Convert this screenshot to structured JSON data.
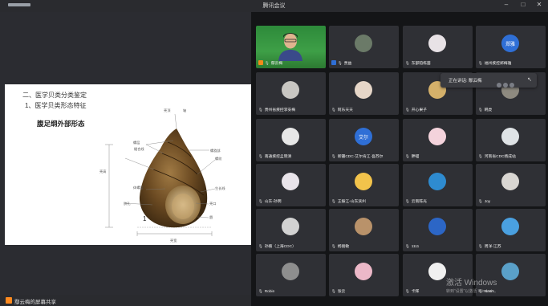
{
  "app": {
    "title": "腾讯会议"
  },
  "window_controls": {
    "minimize": "–",
    "maximize": "□",
    "close": "✕"
  },
  "slide": {
    "heading1": "二、医学贝类分类鉴定",
    "heading2": "1、医学贝类形态特征",
    "figure_title": "腹足纲外部形态",
    "labels": {
      "apex": "壳顶",
      "whorl": "螺层",
      "body_whorl": "体螺层",
      "shell_height": "壳高",
      "suture": "缝合线",
      "spire": "螺旋部",
      "spiral_lines": "螺纹",
      "shell_width": "壳宽",
      "aperture": "壳口",
      "umbilicus": "脐孔",
      "operculum": "厣",
      "lip": "唇",
      "columella": "壳轴",
      "growth_lines": "生长线",
      "axis": "轴"
    },
    "label_1": "1"
  },
  "share_bar": {
    "text": "鄢云梅的屏幕共享"
  },
  "speaking_popup": {
    "text": "正在讲话: 鄢云梅",
    "close_icon": "↖"
  },
  "participants": [
    {
      "name": "鄢云梅",
      "host": true,
      "video": true
    },
    {
      "name": "贾益",
      "host": true,
      "avatar_color": "#6b7a68"
    },
    {
      "name": "东部陪练菌",
      "avatar_color": "#e8e2e6"
    },
    {
      "name": "福州疾控郑梅雅",
      "avatar_text": "郑雅",
      "avatar_color": "#2f6fd6"
    },
    {
      "name": "贵州省疾控李安梅",
      "avatar_color": "#c8c6c2"
    },
    {
      "name": "阿乐天天",
      "avatar_color": "#e6d6c8"
    },
    {
      "name": "开心果子",
      "avatar_color": "#d4b06a"
    },
    {
      "name": "韩虎",
      "avatar_color": "#8e8a80"
    },
    {
      "name": "南通疾控孟晓清",
      "avatar_color": "#e7e7e7"
    },
    {
      "name": "新疆CDC-艾尔肯江·吾苏尔",
      "avatar_text": "艾尔",
      "avatar_color": "#2f6fd6"
    },
    {
      "name": "胖喵",
      "avatar_color": "#f4d3dc"
    },
    {
      "name": "河南省CDC杨成站",
      "avatar_color": "#dfe3e6"
    },
    {
      "name": "山东-孙明",
      "avatar_color": "#e9e4ea"
    },
    {
      "name": "王振江-山东滨州",
      "avatar_color": "#f2c34b"
    },
    {
      "name": "云南陈光",
      "avatar_color": "#2e8bd0"
    },
    {
      "name": "Joy",
      "avatar_color": "#d9d6d2"
    },
    {
      "name": "孙楠（上海CDC）",
      "avatar_color": "#d2d2d2"
    },
    {
      "name": "杨丽敏",
      "avatar_color": "#b9926a"
    },
    {
      "name": "1111",
      "avatar_color": "#2c66c6"
    },
    {
      "name": "周洋-江苏",
      "avatar_color": "#4aa0e0"
    },
    {
      "name": "Robin",
      "avatar_color": "#8e8e8e"
    },
    {
      "name": "张云",
      "avatar_color": "#ecb8c8"
    },
    {
      "name": "卡辉",
      "avatar_color": "#f0f0f0"
    },
    {
      "name": "Nash",
      "avatar_color": "#5aa0c8"
    }
  ],
  "watermark": {
    "line1": "激活 Windows",
    "line2": "转到“设置”以激活 Windows。"
  }
}
